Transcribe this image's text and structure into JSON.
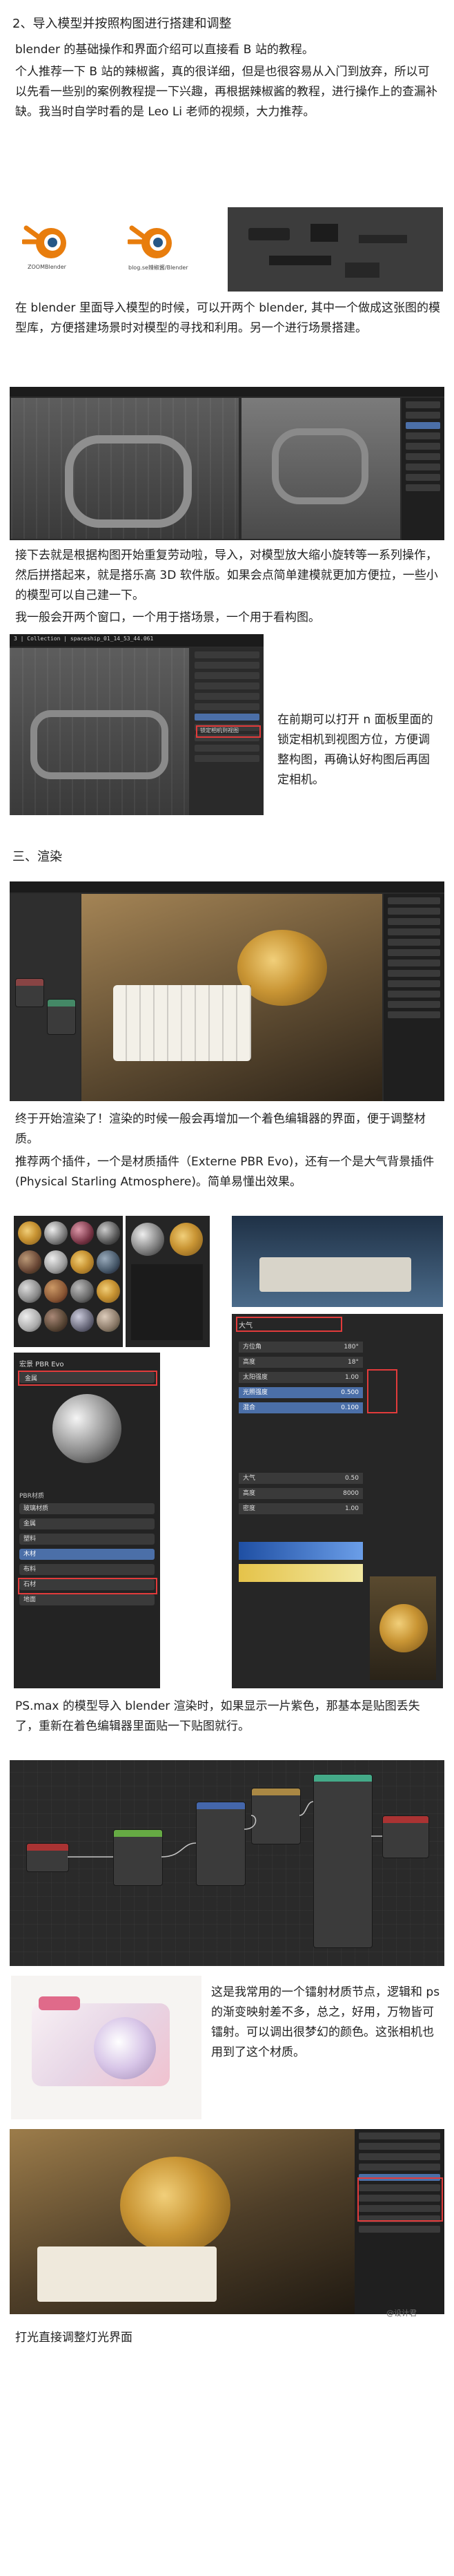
{
  "section2": {
    "title": "2、导入模型并按照构图进行搭建和调整",
    "p1": "blender 的基础操作和界面介绍可以直接看 B 站的教程。",
    "p2": "个人推荐一下 B 站的辣椒酱，真的很详细，但是也很容易从入门到放弃，所以可以先看一些别的案例教程提一下兴趣，再根据辣椒酱的教程，进行操作上的查漏补缺。我当时自学时看的是 Leo Li 老师的视频，大力推荐。",
    "logo1_caption": "ZOOMBlender",
    "logo2_caption": "blog.se辣椒酱/Blender",
    "p3": "在 blender 里面导入模型的时候，可以开两个 blender, 其中一个做成这张图的模型库，方便搭建场景时对模型的寻找和利用。另一个进行场景搭建。",
    "p4": "接下去就是根据构图开始重复劳动啦，导入，对模型放大缩小旋转等一系列操作，然后拼搭起来，就是搭乐高 3D 软件版。如果会点简单建模就更加方便拉，一些小的模型可以自己建一下。",
    "p5": "我一般会开两个窗口，一个用于搭场景，一个用于看构图。",
    "side_note": "在前期可以打开 n 面板里面的锁定相机到视图方位，方便调整构图，再确认好构图后再固定相机。",
    "collection_title": "3 | Collection | spaceship_01_14_53_44.061",
    "lock_label": "锁定相机到视图"
  },
  "section3": {
    "title": "三、渲染",
    "p1": "终于开始渲染了！渲染的时候一般会再增加一个着色编辑器的界面，便于调整材质。",
    "p2": "推荐两个插件，一个是材质插件（Externe PBR Evo)，还有一个是大气背景插件 (Physical Starling Atmosphere)。简单易懂出效果。",
    "pbr_panel_title": "宏景 PBR Evo",
    "pbr_category": "金属",
    "pbr_section": "PBR材质",
    "pbr_items": [
      "玻璃材质",
      "金属",
      "塑料",
      "木材",
      "布料",
      "石材",
      "地面"
    ],
    "atmo_panel_title": "大气",
    "atmo_rows": [
      {
        "label": "方位角",
        "value": "180°"
      },
      {
        "label": "高度",
        "value": "18°"
      },
      {
        "label": "太阳强度",
        "value": "1.00"
      },
      {
        "label": "光照强度",
        "value": "0.500"
      },
      {
        "label": "混合",
        "value": "0.100"
      }
    ],
    "atmo_rows2": [
      {
        "label": "大气",
        "value": "0.50"
      },
      {
        "label": "高度",
        "value": "8000"
      },
      {
        "label": "密度",
        "value": "1.00"
      }
    ],
    "p3": "PS.max 的模型导入 blender 渲染时，如果显示一片紫色，那基本是贴图丢失了，重新在着色编辑器里面贴一下贴图就行。",
    "node_note": "这是我常用的一个镭射材质节点，逻辑和 ps 的渐变映射差不多，总之，好用，万物皆可镭射。可以调出很梦幻的颜色。这张相机也用到了这个材质。",
    "closing": "打光直接调整灯光界面"
  },
  "watermark": "@设计君",
  "colors": {
    "accent_red": "#e23b3b",
    "blender_orange": "#e87d0d",
    "blender_blue": "#265787"
  }
}
